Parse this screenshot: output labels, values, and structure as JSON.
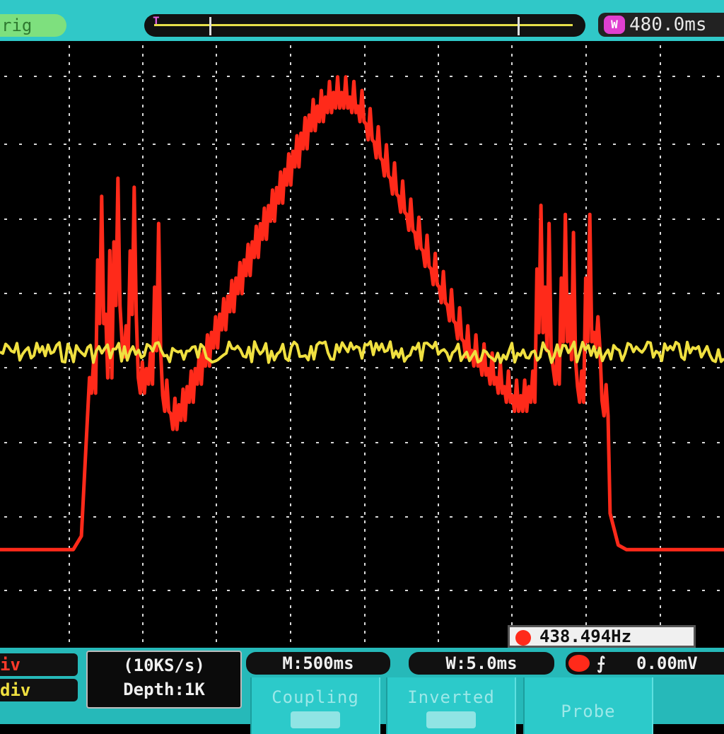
{
  "header": {
    "trigger_status": "rig",
    "time_offset": "480.0ms",
    "scope_icon": "waveform-icon"
  },
  "measurements": {
    "frequency": "438.494Hz"
  },
  "footer": {
    "ch1_scale": "iv",
    "ch2_scale": "div",
    "sample_rate": "(10KS/s)",
    "memory_depth": "Depth:1K",
    "main_timebase": "M:500ms",
    "window_timebase": "W:5.0ms",
    "trigger_edge_icon": "rising-edge-icon",
    "trigger_level": "0.00mV"
  },
  "softkeys": {
    "coupling": "Coupling",
    "inverted": "Inverted",
    "probe": "Probe"
  },
  "colors": {
    "ch1": "#ff2a1a",
    "ch2": "#f0e040",
    "grid": "#d8d8d8",
    "chrome": "#30c8c8"
  },
  "chart_data": {
    "type": "line",
    "grid": true,
    "series": [
      {
        "channel": "CH1",
        "color": "#ff2a1a",
        "description_values": [
          0.22,
          0.22,
          0.22,
          0.22,
          0.22,
          0.22,
          0.22,
          0.22,
          0.22,
          0.22,
          0.25,
          0.6,
          0.86,
          0.74,
          0.9,
          0.68,
          0.88,
          0.6,
          0.62,
          0.8,
          0.56,
          0.52,
          0.54,
          0.58,
          0.62,
          0.66,
          0.7,
          0.74,
          0.78,
          0.82,
          0.86,
          0.9,
          0.94,
          0.98,
          1.02,
          1.06,
          1.1,
          1.14,
          1.18,
          1.2,
          1.22,
          1.23,
          1.23,
          1.22,
          1.2,
          1.16,
          1.12,
          1.08,
          1.04,
          1.0,
          0.96,
          0.92,
          0.88,
          0.84,
          0.8,
          0.76,
          0.72,
          0.68,
          0.66,
          0.64,
          0.62,
          0.6,
          0.58,
          0.56,
          0.56,
          0.58,
          0.84,
          0.8,
          0.62,
          0.82,
          0.78,
          0.58,
          0.82,
          0.7,
          0.55,
          0.3,
          0.23,
          0.22,
          0.22,
          0.22,
          0.22,
          0.22,
          0.22,
          0.22,
          0.22,
          0.22,
          0.22,
          0.22,
          0.22,
          0.22
        ]
      },
      {
        "channel": "CH2",
        "color": "#f0e040",
        "level": 0.6
      }
    ]
  }
}
